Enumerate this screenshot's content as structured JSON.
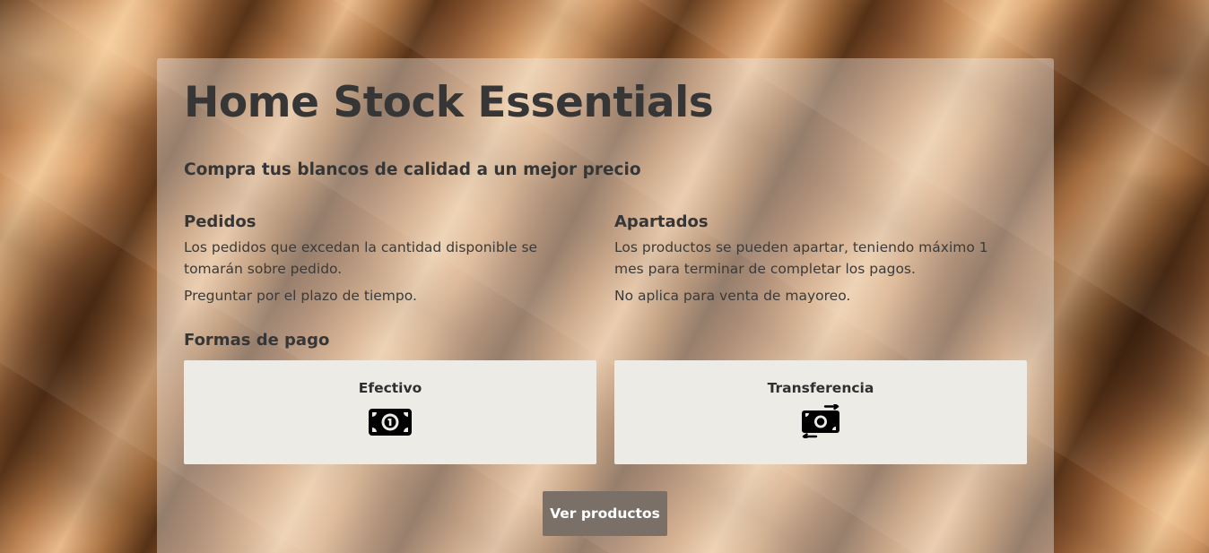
{
  "hero": {
    "title": "Home Stock Essentials",
    "subtitle": "Compra tus blancos de calidad a un mejor precio"
  },
  "pedidos": {
    "heading": "Pedidos",
    "paragraphs": [
      "Los pedidos que excedan la cantidad disponible se tomarán sobre pedido.",
      "Preguntar por el plazo de tiempo."
    ]
  },
  "apartados": {
    "heading": "Apartados",
    "paragraphs": [
      "Los productos se pueden apartar, teniendo máximo 1 mes para terminar de completar los pagos.",
      "No aplica para venta de mayoreo."
    ]
  },
  "payments": {
    "heading": "Formas de pago",
    "methods": [
      {
        "label": "Efectivo",
        "icon": "money-bill-icon"
      },
      {
        "label": "Transferencia",
        "icon": "money-transfer-icon"
      }
    ]
  },
  "cta": {
    "label": "Ver productos"
  },
  "colors": {
    "button_bg": "#7b7067",
    "card_bg": "#edebe6",
    "text": "#363636"
  }
}
